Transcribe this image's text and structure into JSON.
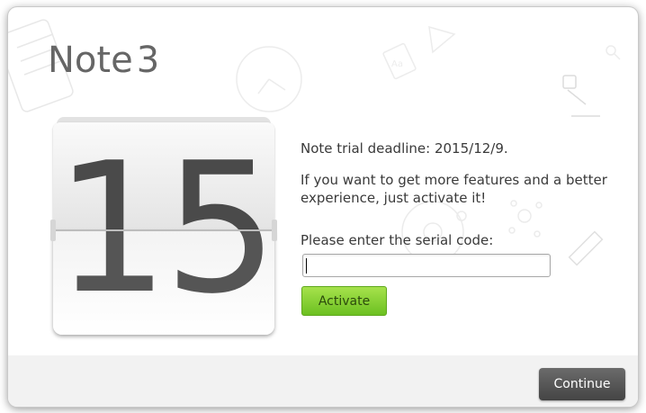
{
  "app": {
    "title": "Note",
    "version": "3"
  },
  "calendar": {
    "days_remaining": "15"
  },
  "message": {
    "deadline": "Note trial deadline: 2015/12/9.",
    "features": "If you want to get more features and a better experience, just activate it!",
    "serial_prompt": "Please enter the serial code:"
  },
  "serial_input": {
    "value": "",
    "placeholder": ""
  },
  "buttons": {
    "activate_label": "Activate",
    "continue_label": "Continue"
  },
  "colors": {
    "activate_green": "#7cc72a",
    "continue_gray": "#555555",
    "title_gray": "#666666"
  },
  "icons": [
    "clock-icon",
    "font-book-icon",
    "triangle-ruler-icon",
    "lamp-icon",
    "key-icon",
    "molecule-icon",
    "ruler-pencil-icon",
    "disc-icon",
    "keyboard-icon"
  ]
}
